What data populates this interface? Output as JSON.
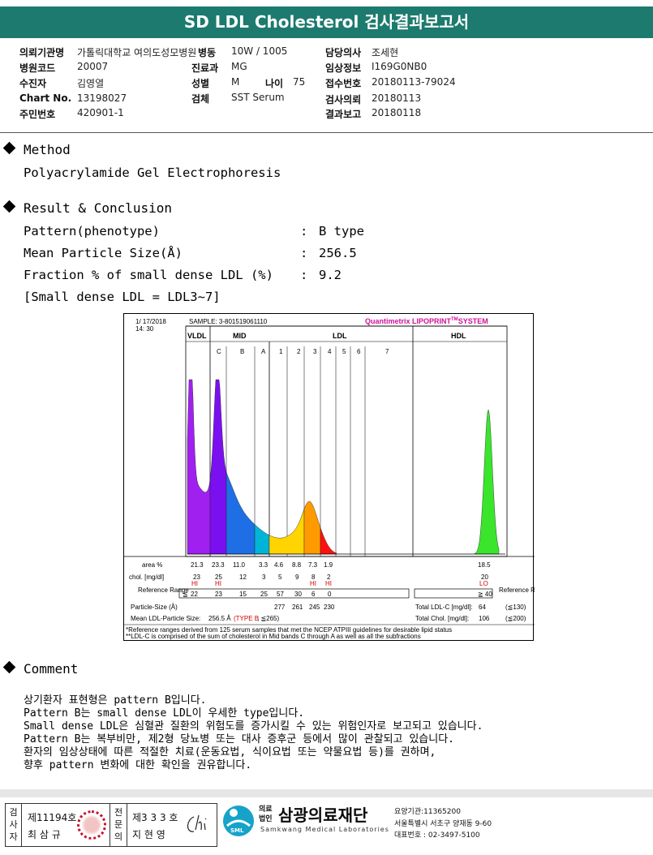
{
  "title": "SD LDL Cholesterol 검사결과보고서",
  "info": {
    "institution_label": "의뢰기관명",
    "institution": "가톨릭대학교 여의도성모병원",
    "ward_label": "병동",
    "ward": "10W / 1005",
    "doctor_label": "담당의사",
    "doctor": "조세현",
    "hospital_code_label": "병원코드",
    "hospital_code": "20007",
    "dept_label": "진료과",
    "dept": "MG",
    "clinical_label": "임상정보",
    "clinical": "I169G0NB0",
    "patient_label": "수진자",
    "patient": "김영열",
    "sex_label": "성별",
    "sex": "M",
    "age_label": "나이",
    "age": "75",
    "receipt_label": "접수번호",
    "receipt": "20180113-79024",
    "chart_label": "Chart No.",
    "chart": "13198027",
    "specimen_label": "검체",
    "specimen": "SST Serum",
    "request_label": "검사의뢰",
    "request": "20180113",
    "resident_label": "주민번호",
    "resident": "420901-1",
    "report_label": "결과보고",
    "report": "20180118"
  },
  "method": {
    "heading": "Method",
    "text": "Polyacrylamide Gel Electrophoresis"
  },
  "result": {
    "heading": "Result & Conclusion",
    "rows": [
      {
        "label": "Pattern(phenotype)",
        "colon": ":",
        "value": "B type"
      },
      {
        "label": "Mean Particle Size(Å)",
        "colon": ":",
        "value": "256.5"
      },
      {
        "label": "Fraction % of small dense LDL (%)",
        "colon": ":",
        "value": "9.2"
      }
    ],
    "note": "[Small dense LDL = LDL3~7]"
  },
  "chart_data": {
    "type": "area",
    "date": "1/ 17/2018",
    "time": "14: 30",
    "sample": "SAMPLE:   3-801519061110",
    "system": "Quantimetrix LIPOPRINT",
    "system_tm": "TM",
    "system_suffix": "SYSTEM",
    "groups": [
      "VLDL",
      "MID",
      "LDL",
      "HDL"
    ],
    "bands": [
      "C",
      "B",
      "A",
      "1",
      "2",
      "3",
      "4",
      "5",
      "6",
      "7"
    ],
    "area_label": "area %",
    "area": [
      21.3,
      23.3,
      11.0,
      3.3,
      4.6,
      8.8,
      7.3,
      1.9,
      18.5
    ],
    "area_text": [
      "21.3",
      "23.3",
      "11.0",
      "3.3",
      "4.6",
      "8.8",
      "7.3",
      "1.9",
      "18.5"
    ],
    "chol_label": "chol. [mg/dl]",
    "chol": [
      "23",
      "25",
      "12",
      "3",
      "5",
      "9",
      "8",
      "2",
      "20"
    ],
    "flags": [
      "HI",
      "HI",
      "HI",
      "HI",
      "LO"
    ],
    "reference_label": "Reference Range",
    "reference_le": "≦",
    "reference_values": [
      "22",
      "23",
      "15",
      "25",
      "57",
      "30",
      "6",
      "0"
    ],
    "reference_hdl": "≧ 40",
    "reference_right": "Reference Range",
    "particle_size_label": "Particle-Size (Å)",
    "particle_sizes": [
      "277",
      "261",
      "245",
      "230"
    ],
    "total_ldl_label": "Total LDL-C [mg/dl]:",
    "total_ldl": "64",
    "total_ldl_ref": "(≦130)",
    "mean_size_label": "Mean LDL-Particle Size:",
    "mean_size": "256.5 Å",
    "mean_type": "(TYPE B",
    "mean_ref": "; ≦265)",
    "total_chol_label": "Total Chol. [mg/dl]:",
    "total_chol": "106",
    "total_chol_ref": "(≦200)",
    "footnote1": "*Reference ranges derived from 125 serum samples that met the NCEP ATPIII guidelines for desirable lipid status",
    "footnote2": "**LDL-C is comprised of the sum of cholesterol in Mid bands C through A as well as all the subfractions",
    "colors": {
      "vldl": "#a020f0",
      "mid_c": "#7a10f0",
      "mid_b": "#1e6fe6",
      "mid_a": "#00b4d8",
      "ldl1": "#ffd400",
      "ldl2": "#ff9a00",
      "ldl3": "#ff1010",
      "hdl": "#3ae52c"
    }
  },
  "comment": {
    "heading": "Comment",
    "lines": [
      "상기환자 표현형은 pattern B입니다.",
      "Pattern B는 small dense LDL이 우세한 type입니다.",
      "Small dense LDL은 심혈관 질환의 위험도를 증가시킬 수 있는 위험인자로 보고되고 있습니다.",
      "Pattern B는 복부비만, 제2형 당뇨병 또는 대사 증후군 등에서 많이 관찰되고 있습니다.",
      "환자의 임상상태에 따른 적절한 치료(운동요법, 식이요법 또는 약물요법 등)를 권하며,",
      "향후 pattern 변화에 대한 확인을 권유합니다."
    ]
  },
  "footer": {
    "tester_label": "검사자",
    "tester_no": "제11194호",
    "tester_name": "최 삼 규",
    "specialist_label": "전문의",
    "specialist_no": "제3 3 3 호",
    "specialist_name": "지 현 영",
    "org_prefix": "의료법인",
    "org_name": "삼광의료재단",
    "org_english": "Samkwang Medical Laboratories",
    "sml": "SML",
    "code": "요양기관:11365200",
    "address": "서울특별시 서초구 양재동 9-60",
    "phone": "대표번호 : 02-3497-5100"
  }
}
